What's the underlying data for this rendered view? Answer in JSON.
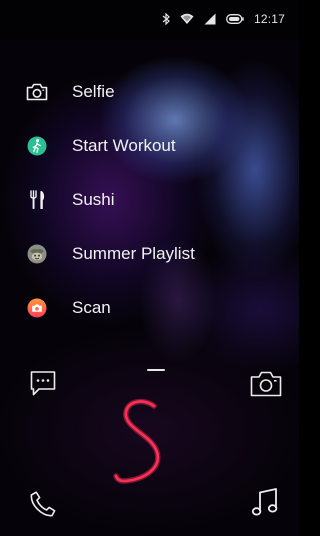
{
  "status_bar": {
    "time": "12:17",
    "icons": [
      "bluetooth-icon",
      "wifi-icon",
      "signal-icon",
      "battery-icon"
    ]
  },
  "menu": {
    "items": [
      {
        "label": "Selfie",
        "icon": "camera-icon"
      },
      {
        "label": "Start Workout",
        "icon": "workout-icon",
        "icon_color": "#2bbf94"
      },
      {
        "label": "Sushi",
        "icon": "fork-knife-icon"
      },
      {
        "label": "Summer Playlist",
        "icon": "playlist-art-icon"
      },
      {
        "label": "Scan",
        "icon": "scan-icon",
        "icon_color": "#ff6b3d"
      }
    ]
  },
  "bottom": {
    "left_top_icon": "chat-icon",
    "right_top_icon": "camera-icon",
    "left_bottom_icon": "phone-icon",
    "right_bottom_icon": "music-icon",
    "gesture": {
      "letter": "S",
      "color": "#ff2f55"
    }
  }
}
